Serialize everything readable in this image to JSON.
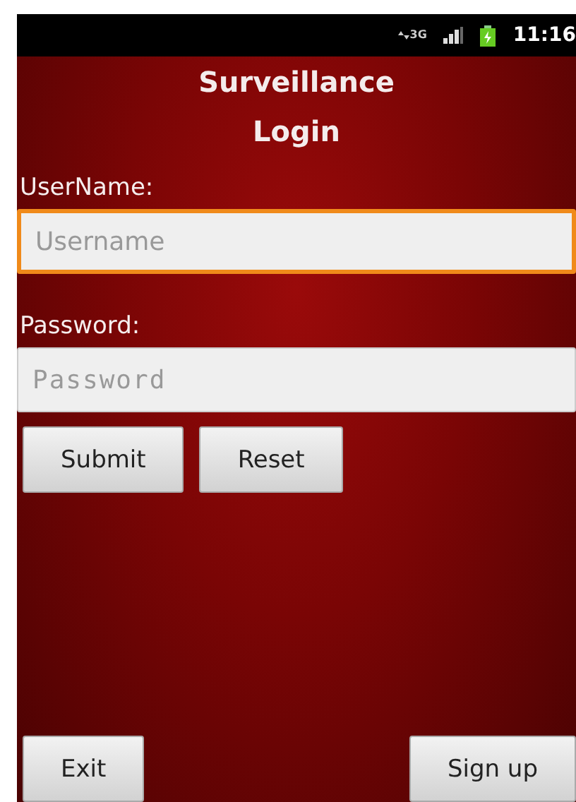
{
  "status_bar": {
    "network": "3G",
    "time": "11:16"
  },
  "title": [
    "Surveillance",
    "Login"
  ],
  "fields": [
    {
      "label": "UserName:",
      "placeholder": "Username",
      "focused": true,
      "kind": "text"
    },
    {
      "label": "Password:",
      "placeholder": "Password",
      "focused": false,
      "kind": "password"
    }
  ],
  "form_buttons": [
    "Submit",
    "Reset"
  ],
  "bottom_buttons": [
    "Exit",
    "Sign up"
  ]
}
